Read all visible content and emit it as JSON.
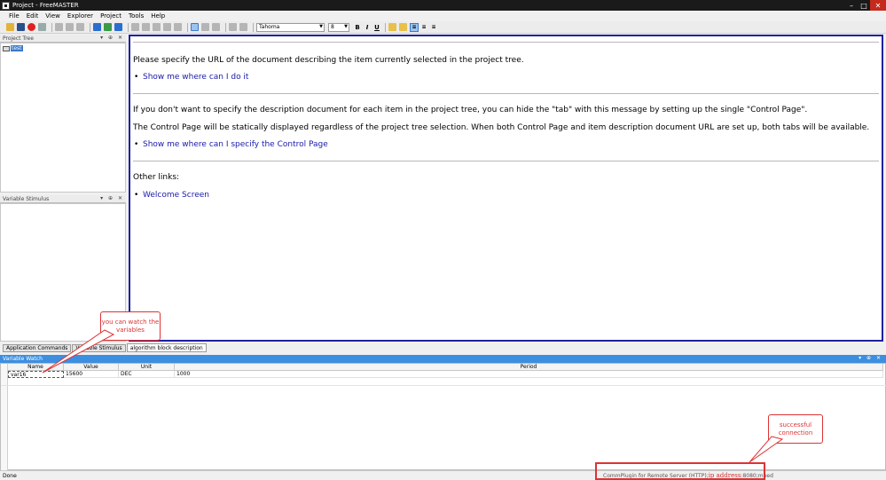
{
  "window": {
    "title": "Project - FreeMASTER"
  },
  "menu": [
    "File",
    "Edit",
    "View",
    "Explorer",
    "Project",
    "Tools",
    "Help"
  ],
  "toolbar": {
    "font_name": "Tahoma",
    "font_size": "8"
  },
  "project_tree": {
    "title": "Project Tree",
    "item": "test"
  },
  "variable_stimulus": {
    "title": "Variable Stimulus"
  },
  "content": {
    "p1": "Please specify the URL of the document describing the item currently selected in the project tree.",
    "link1": "Show me where can I do it",
    "p2": "If you don't want to specify the description document for each item in the project tree, you can hide the \"tab\" with this message by setting up the single \"Control Page\".",
    "p3": "The Control Page will be statically displayed regardless of the project tree selection. When both Control Page and item description document URL are set up, both tabs will be available.",
    "link2": "Show me where can I specify the Control Page",
    "p4": "Other links:",
    "link3": "Welcome Screen"
  },
  "tabs": [
    "Application Commands",
    "Variable Stimulus",
    "algorithm block description"
  ],
  "variable_watch": {
    "title": "Variable Watch",
    "columns": [
      "Name",
      "Value",
      "Unit",
      "Period"
    ],
    "rows": [
      {
        "name": "var16",
        "value": "15600",
        "unit": "DEC",
        "period": "1000"
      }
    ]
  },
  "status": {
    "left": "Done",
    "conn_prefix": "CommPlugin for Remote Server (HTTP);",
    "conn_ip": "ip address",
    "conn_suffix": ":8080;mbed"
  },
  "annotations": {
    "watch": "you can watch the variables",
    "connection": "successful connection",
    "color": "#d33333"
  }
}
